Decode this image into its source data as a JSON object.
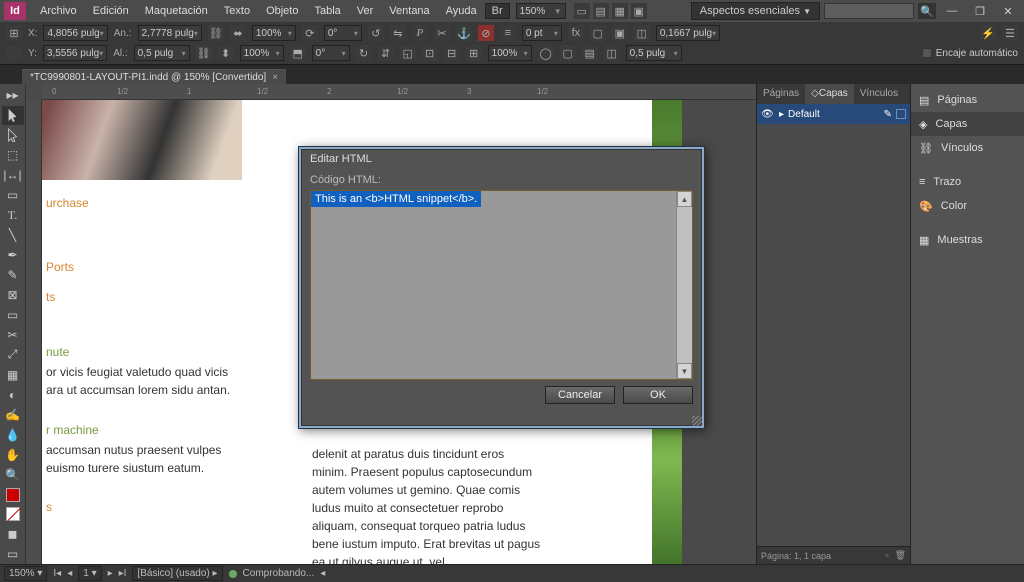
{
  "logo": "Id",
  "menu": [
    "Archivo",
    "Edición",
    "Maquetación",
    "Texto",
    "Objeto",
    "Tabla",
    "Ver",
    "Ventana",
    "Ayuda"
  ],
  "br": "Br",
  "zoom_menu": "150%",
  "workspace_preset": "Aspectos esenciales",
  "controls": {
    "x": "4,8056 pulg",
    "y": "3,5556 pulg",
    "w": "2,7778 pulg",
    "h": "0,5 pulg",
    "scalex": "100%",
    "scaley": "100%",
    "rotate": "0°",
    "shear": "0°",
    "stroke_pt": "0 pt",
    "stroke_fill": "100%",
    "opacity": "0,1667 pulg",
    "gap": "0,5 pulg",
    "encaje": "Encaje automático"
  },
  "ruler_marks": [
    "0",
    "1/2",
    "1",
    "1/2",
    "2",
    "1/2",
    "3",
    "1/2"
  ],
  "tab_title": "*TC9990801-LAYOUT-PI1.indd @ 150% [Convertido]",
  "doc": {
    "h1": "urchase",
    "h2": "Ports",
    "h3": "ts",
    "h4": "nute",
    "b1a": "or vicis feugiat valetudo quad vicis",
    "b1b": "ara ut accumsan lorem sidu antan.",
    "h5": "r machine",
    "b2a": "accumsan nutus praesent vulpes",
    "b2b": "euismo turere siustum eatum.",
    "h6": "s",
    "col2": "delenit at paratus duis tincidunt eros minim. Praesent populus captosecundum autem volumes ut gemino. Quae comis ludus muito at consectetuer reprobo aliquam, consequat torqueo patria ludus bene iustum imputo. Erat brevitas ut pagus ea ut gilvus augue ut, vel"
  },
  "panels": {
    "tabs": [
      "Páginas",
      "Capas",
      "Vínculos"
    ],
    "layer": "Default",
    "footer": "Página: 1, 1 capa"
  },
  "iconbar": [
    "Páginas",
    "Capas",
    "Vínculos",
    "Trazo",
    "Color",
    "Muestras"
  ],
  "status": {
    "zoom": "150%",
    "page": "1",
    "preset": "[Básico] (usado)",
    "check": "Comprobando..."
  },
  "dialog": {
    "title": "Editar HTML",
    "label": "Código HTML:",
    "content": "This is an <b>HTML snippet</b>.",
    "cancel": "Cancelar",
    "ok": "OK"
  }
}
